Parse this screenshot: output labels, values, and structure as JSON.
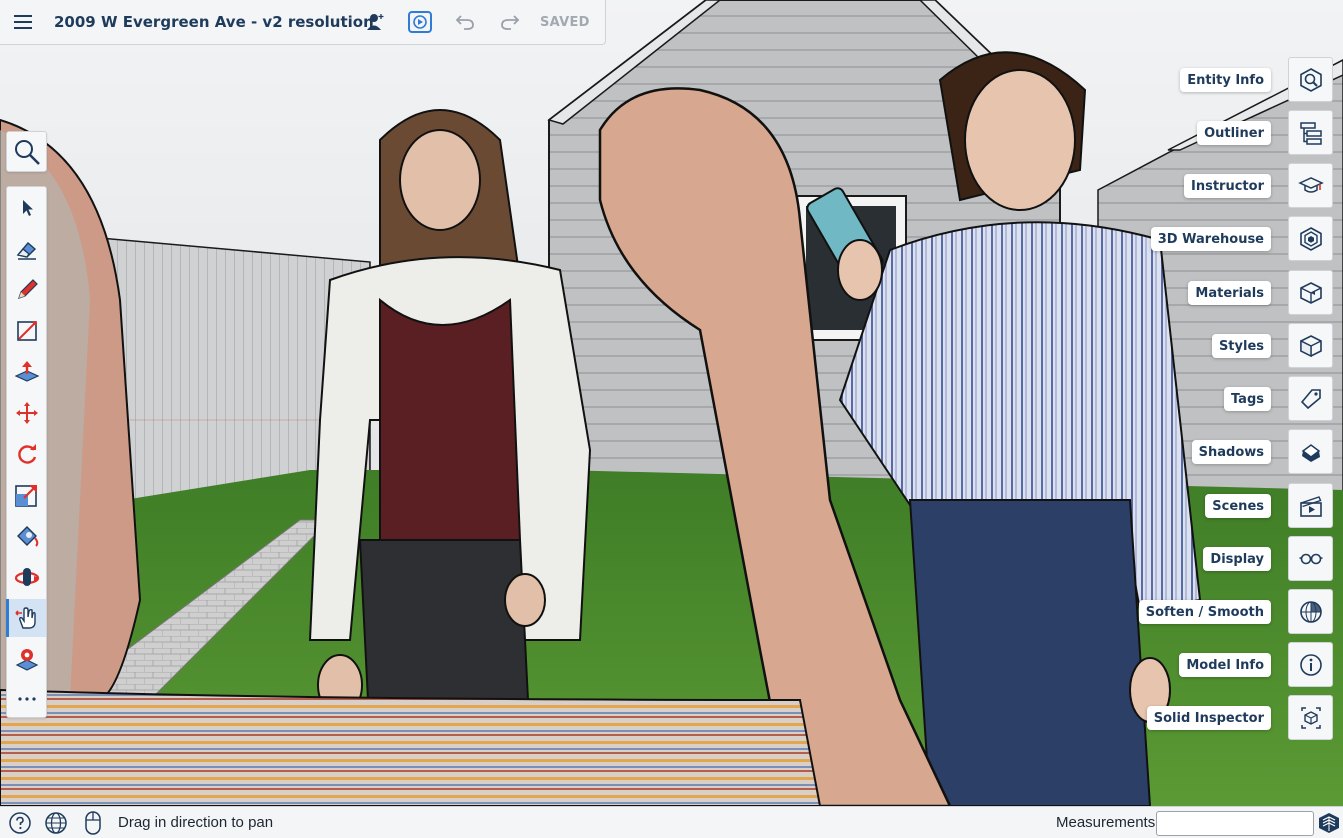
{
  "header": {
    "title": "2009 W Evergreen Ave - v2 resolution",
    "status": "SAVED",
    "menu_icon": "hamburger-menu-icon",
    "share_icon": "add-person-icon",
    "present_icon": "play-presentation-icon",
    "undo_icon": "undo-icon",
    "redo_icon": "redo-icon"
  },
  "left_toolbar": {
    "search_icon": "search-icon",
    "active_tool": "pan",
    "tools": [
      "select",
      "eraser",
      "pencil",
      "shape",
      "push-pull",
      "move",
      "rotate",
      "scale",
      "paint-bucket",
      "orbit",
      "pan",
      "position-camera",
      "more"
    ]
  },
  "right_panels": [
    {
      "label": "Entity Info",
      "icon": "entity-info-icon"
    },
    {
      "label": "Outliner",
      "icon": "outliner-icon"
    },
    {
      "label": "Instructor",
      "icon": "graduation-cap-icon"
    },
    {
      "label": "3D Warehouse",
      "icon": "warehouse-icon"
    },
    {
      "label": "Materials",
      "icon": "materials-cube-icon"
    },
    {
      "label": "Styles",
      "icon": "styles-cube-icon"
    },
    {
      "label": "Tags",
      "icon": "tag-icon"
    },
    {
      "label": "Shadows",
      "icon": "shadow-icon"
    },
    {
      "label": "Scenes",
      "icon": "clapperboard-icon"
    },
    {
      "label": "Display",
      "icon": "glasses-icon"
    },
    {
      "label": "Soften / Smooth",
      "icon": "sphere-icon"
    },
    {
      "label": "Model Info",
      "icon": "info-icon"
    },
    {
      "label": "Solid Inspector",
      "icon": "solid-inspector-icon"
    }
  ],
  "status_bar": {
    "message": "Drag in direction to pan",
    "measurements_label": "Measurements",
    "measurements_value": "",
    "help_icon": "help-icon",
    "globe_icon": "globe-icon",
    "mouse_icon": "mouse-icon",
    "logo_icon": "sketchup-logo-icon"
  },
  "colors": {
    "accent": "#2f7bd6",
    "title_text": "#1f3b5c",
    "tool_red": "#e0302a",
    "grass": "#4e8d2e",
    "sky": "#e4e7ea"
  }
}
